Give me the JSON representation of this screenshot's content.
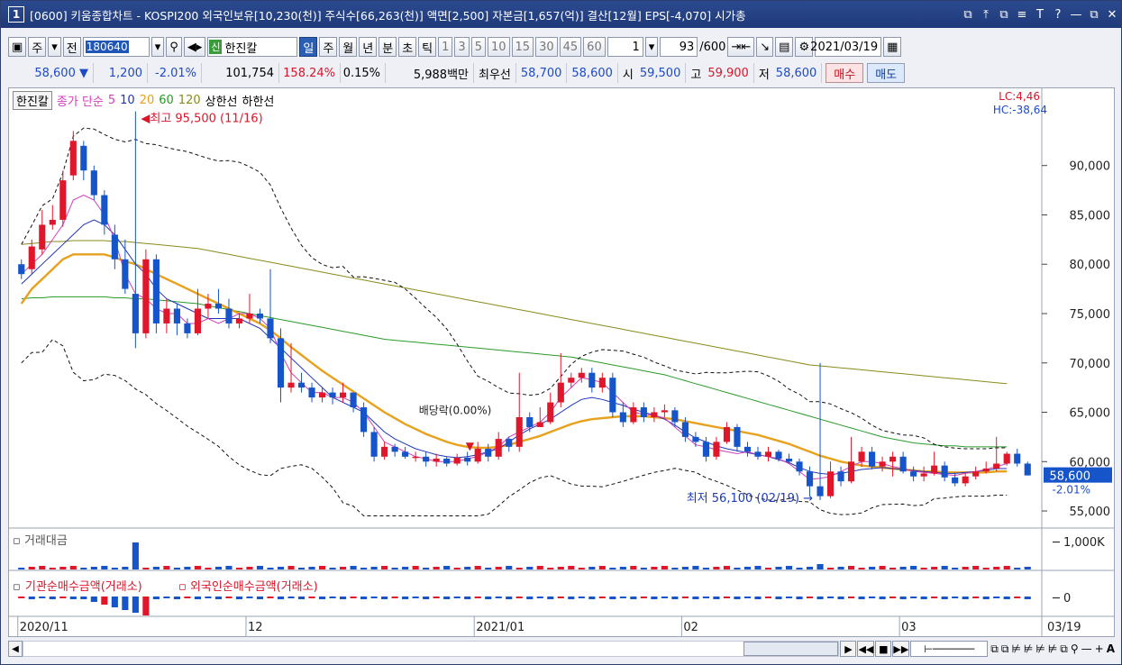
{
  "window": {
    "number": "1",
    "title": "[0600] 키움종합차트 - KOSPI200 외국인보유[10,230(천)] 주식수[66,263(천)] 액면[2,500] 자본금[1,657(억)] 결산[12월] EPS[-4,070] 시가총",
    "buttons": [
      "⧉",
      "⤒",
      "⧉",
      "≡",
      "T",
      "?",
      "—",
      "⧉",
      "✕"
    ]
  },
  "toolbar": {
    "market": "주",
    "all": "전",
    "code": "180640",
    "name_tag": "신",
    "name": "한진칼",
    "periods": [
      "일",
      "주",
      "월",
      "년",
      "분",
      "초",
      "틱"
    ],
    "selected_period": "일",
    "minute_steps": [
      "1",
      "3",
      "5",
      "10",
      "15",
      "30",
      "45",
      "60"
    ],
    "count_select": "1",
    "range": "93",
    "range_total": "/600",
    "date": "2021/03/19"
  },
  "quote": {
    "price": "58,600",
    "arrow": "▼",
    "change": "1,200",
    "change_pct": "-2.01%",
    "volume": "101,754",
    "volume_ratio": "158.24%",
    "turnover": "0.15%",
    "amount": "5,988백만",
    "best_label": "최우선",
    "ask": "58,700",
    "bid": "58,600",
    "open_label": "시",
    "open": "59,500",
    "high_label": "고",
    "high": "59,900",
    "low_label": "저",
    "low": "58,600",
    "buy": "매수",
    "sell": "매도"
  },
  "legend": {
    "name": "한진칼",
    "close_label": "종가 단순",
    "ma": [
      "5",
      "10",
      "20",
      "60",
      "120"
    ],
    "ma_colors": [
      "#d13fb8",
      "#2036b8",
      "#e8a11c",
      "#2a9a2a",
      "#8a8a1d"
    ],
    "upper": "상한선",
    "lower": "하한선"
  },
  "indicators": {
    "lc": "LC:4,46",
    "hc": "HC:-38,64",
    "panel2": "거래대금",
    "panel3a": "기관순매수금액(거래소)",
    "panel3b": "외국인순매수금액(거래소)",
    "panel2_unit": "1,000K",
    "panel3_zero": "0"
  },
  "annotations": {
    "high": "최고 95,500 (11/16)",
    "low": "최저 56,100 (02/19)",
    "dividend": "배당락(0.00%)",
    "last_price": "58,600",
    "last_pct": "-2.01%"
  },
  "x_axis": {
    "labels": [
      "2020/11",
      "12",
      "2021/01",
      "02",
      "03",
      "03/19"
    ]
  },
  "chart_data": {
    "type": "candlestick",
    "y_ticks": [
      55000,
      60000,
      65000,
      70000,
      75000,
      80000,
      85000,
      90000
    ],
    "y_tick_labels": [
      "55,000",
      "60,000",
      "65,000",
      "70,000",
      "75,000",
      "80,000",
      "85,000",
      "90,000"
    ],
    "ylim": [
      54000,
      96000
    ],
    "candles": [
      [
        80000,
        79000,
        80500,
        78500
      ],
      [
        79500,
        81800,
        82500,
        79000
      ],
      [
        81500,
        84000,
        85500,
        81000
      ],
      [
        84000,
        84500,
        86000,
        83500
      ],
      [
        84500,
        88500,
        89500,
        83800
      ],
      [
        89000,
        92500,
        93500,
        88500
      ],
      [
        92000,
        89500,
        92500,
        88500
      ],
      [
        89500,
        87000,
        90000,
        86500
      ],
      [
        87000,
        84000,
        87500,
        83000
      ],
      [
        83000,
        80500,
        84000,
        79500
      ],
      [
        80500,
        77500,
        82500,
        77000
      ],
      [
        77000,
        73000,
        95500,
        71500
      ],
      [
        73000,
        80500,
        81500,
        72500
      ],
      [
        80500,
        74000,
        81000,
        73000
      ],
      [
        74000,
        75500,
        76500,
        73000
      ],
      [
        75500,
        74000,
        76000,
        72800
      ],
      [
        74000,
        73000,
        74500,
        72500
      ],
      [
        73000,
        75500,
        77500,
        72800
      ],
      [
        75500,
        76000,
        77000,
        74500
      ],
      [
        76000,
        75500,
        77500,
        75000
      ],
      [
        75500,
        74000,
        76500,
        73500
      ],
      [
        74000,
        74500,
        75000,
        73500
      ],
      [
        74500,
        75000,
        77000,
        74000
      ],
      [
        75000,
        74500,
        75500,
        74000
      ],
      [
        74500,
        72500,
        79500,
        72000
      ],
      [
        72500,
        67500,
        73500,
        66000
      ],
      [
        67500,
        68000,
        72000,
        67000
      ],
      [
        68000,
        67500,
        69000,
        67000
      ],
      [
        67500,
        66500,
        68000,
        66000
      ],
      [
        66500,
        67000,
        67500,
        66000
      ],
      [
        67000,
        66500,
        67500,
        65800
      ],
      [
        66500,
        67000,
        68000,
        66000
      ],
      [
        67000,
        65500,
        67000,
        65000
      ],
      [
        65500,
        63000,
        66000,
        62500
      ],
      [
        63000,
        60500,
        63500,
        60000
      ],
      [
        60500,
        61500,
        62000,
        60200
      ],
      [
        61500,
        61000,
        61800,
        60500
      ],
      [
        61000,
        60500,
        61500,
        60300
      ],
      [
        60500,
        60500,
        61000,
        60000
      ],
      [
        60500,
        60000,
        61000,
        59500
      ],
      [
        60000,
        60300,
        60800,
        59500
      ],
      [
        60300,
        59800,
        60500,
        59500
      ],
      [
        59800,
        60400,
        60800,
        59600
      ],
      [
        60400,
        60000,
        61000,
        59600
      ],
      [
        60000,
        61300,
        62000,
        59800
      ],
      [
        61300,
        60500,
        61800,
        60000
      ],
      [
        60500,
        62300,
        63000,
        60200
      ],
      [
        62300,
        61500,
        62500,
        61000
      ],
      [
        61500,
        64500,
        69000,
        61000
      ],
      [
        64500,
        63500,
        65000,
        63000
      ],
      [
        63500,
        64000,
        65500,
        63500
      ],
      [
        64000,
        66000,
        67000,
        63800
      ],
      [
        66000,
        68000,
        71000,
        65500
      ],
      [
        68000,
        68500,
        69000,
        67500
      ],
      [
        68500,
        69000,
        69500,
        68000
      ],
      [
        69000,
        67500,
        69500,
        67000
      ],
      [
        67500,
        68500,
        69000,
        67000
      ],
      [
        68500,
        65000,
        69000,
        64500
      ],
      [
        65000,
        64000,
        66000,
        63500
      ],
      [
        64000,
        65500,
        66000,
        63800
      ],
      [
        65500,
        64500,
        66000,
        64000
      ],
      [
        64500,
        65000,
        65500,
        64000
      ],
      [
        65000,
        65200,
        65800,
        64500
      ],
      [
        65200,
        64000,
        65500,
        63500
      ],
      [
        64000,
        62500,
        64500,
        62000
      ],
      [
        62500,
        62000,
        63000,
        61500
      ],
      [
        62000,
        60500,
        62500,
        60000
      ],
      [
        60500,
        62000,
        62500,
        60200
      ],
      [
        62000,
        63500,
        64000,
        61800
      ],
      [
        63500,
        61500,
        63800,
        61000
      ],
      [
        61500,
        61000,
        62000,
        60500
      ],
      [
        61000,
        60500,
        61500,
        60200
      ],
      [
        60500,
        61000,
        61500,
        60000
      ],
      [
        61000,
        60300,
        61200,
        60000
      ],
      [
        60300,
        60000,
        60800,
        59800
      ],
      [
        60000,
        59000,
        60300,
        58600
      ],
      [
        59000,
        57500,
        59500,
        56500
      ],
      [
        57500,
        56500,
        70000,
        56100
      ],
      [
        56500,
        59000,
        60000,
        56300
      ],
      [
        59000,
        58000,
        59500,
        57500
      ],
      [
        58000,
        60000,
        62500,
        57800
      ],
      [
        60000,
        61000,
        61500,
        59500
      ],
      [
        61000,
        59500,
        61500,
        59200
      ],
      [
        59500,
        60000,
        60500,
        59000
      ],
      [
        60000,
        60500,
        61000,
        58500
      ],
      [
        60500,
        59000,
        61000,
        58800
      ],
      [
        59000,
        58500,
        59500,
        58000
      ],
      [
        58500,
        58800,
        59500,
        58000
      ],
      [
        58800,
        59600,
        61000,
        58600
      ],
      [
        59600,
        58400,
        60000,
        58000
      ],
      [
        58400,
        57800,
        58900,
        57500
      ],
      [
        57800,
        58500,
        58800,
        57500
      ],
      [
        58500,
        59000,
        59500,
        58200
      ],
      [
        59000,
        59300,
        60000,
        58800
      ],
      [
        59300,
        59800,
        62500,
        59000
      ],
      [
        59800,
        60800,
        61000,
        59600
      ],
      [
        60800,
        59800,
        61300,
        59500
      ],
      [
        59800,
        58600,
        60000,
        58600
      ]
    ],
    "ma_series": {
      "ma5": [
        79000,
        80000,
        81000,
        82500,
        84000,
        86500,
        87000,
        86500,
        85000,
        82500,
        79000,
        77000,
        76500,
        75500,
        75000,
        75000,
        74000,
        74000,
        74500,
        74000,
        74500,
        75000,
        75000,
        74500,
        73500,
        71000,
        69000,
        68000,
        67000,
        67000,
        66500,
        66500,
        66000,
        65000,
        63500,
        62000,
        61500,
        61000,
        60500,
        60300,
        60000,
        60000,
        60000,
        60300,
        60500,
        61000,
        61500,
        62500,
        63000,
        63500,
        64000,
        65000,
        66500,
        67500,
        68500,
        68300,
        68000,
        67000,
        66000,
        65000,
        64800,
        64700,
        64400,
        63500,
        62600,
        61700,
        61500,
        61200,
        61000,
        60800,
        61000,
        60700,
        60500,
        60300,
        59800,
        59000,
        58200,
        58300,
        58500,
        59000,
        59500,
        60000,
        60000,
        59800,
        59500,
        59300,
        59000,
        58900,
        58800,
        58700,
        58600,
        58800,
        59000,
        59200,
        59500,
        59800
      ],
      "ma10": [
        78000,
        79000,
        80000,
        81000,
        82000,
        83000,
        84000,
        84500,
        84000,
        83000,
        81500,
        80000,
        79000,
        77500,
        76500,
        76000,
        75500,
        75000,
        74500,
        74500,
        74500,
        74500,
        74000,
        73500,
        72500,
        71500,
        70500,
        69500,
        68500,
        67500,
        66500,
        66000,
        65500,
        65000,
        64000,
        63000,
        62300,
        61800,
        61300,
        61000,
        60700,
        60500,
        60400,
        60500,
        60700,
        61000,
        61300,
        62000,
        62700,
        63300,
        63800,
        64300,
        65000,
        65700,
        66300,
        66500,
        66300,
        66000,
        65700,
        65300,
        65000,
        64700,
        64300,
        63700,
        63000,
        62400,
        62000,
        61600,
        61300,
        61100,
        60900,
        60700,
        60500,
        60200,
        59900,
        59400,
        59000,
        58800,
        58700,
        58800,
        59000,
        59200,
        59300,
        59400,
        59300,
        59200,
        59100,
        59000,
        58900,
        58800,
        58800,
        58900,
        59000,
        59100,
        59300,
        59300
      ],
      "ma20": [
        76000,
        77500,
        78500,
        79500,
        80500,
        81000,
        81000,
        81000,
        81000,
        80700,
        80300,
        80000,
        79500,
        79000,
        78500,
        78000,
        77500,
        77000,
        76500,
        76000,
        75500,
        75000,
        74500,
        74000,
        73300,
        72500,
        71600,
        70800,
        70000,
        69200,
        68500,
        67800,
        67100,
        66400,
        65700,
        65000,
        64400,
        63800,
        63300,
        62800,
        62400,
        62000,
        61700,
        61500,
        61400,
        61400,
        61500,
        61700,
        62000,
        62300,
        62600,
        63000,
        63400,
        63800,
        64100,
        64300,
        64400,
        64500,
        64600,
        64600,
        64600,
        64500,
        64400,
        64300,
        64100,
        63900,
        63700,
        63500,
        63300,
        63100,
        62900,
        62700,
        62400,
        62100,
        61800,
        61400,
        61000,
        60600,
        60300,
        60000,
        59800,
        59600,
        59500,
        59400,
        59300,
        59200,
        59100,
        59000,
        59000,
        58900,
        58900,
        58900,
        58900,
        58900,
        59000,
        59000
      ],
      "ma60": [
        76500,
        76600,
        76600,
        76700,
        76700,
        76700,
        76700,
        76700,
        76700,
        76600,
        76600,
        76500,
        76500,
        76400,
        76300,
        76200,
        76100,
        76000,
        75800,
        75600,
        75400,
        75200,
        75000,
        74800,
        74600,
        74400,
        74200,
        74000,
        73800,
        73600,
        73400,
        73200,
        73000,
        72800,
        72600,
        72400,
        72300,
        72200,
        72100,
        72000,
        71900,
        71800,
        71700,
        71600,
        71500,
        71400,
        71300,
        71200,
        71100,
        71000,
        70900,
        70800,
        70700,
        70600,
        70400,
        70200,
        70000,
        69800,
        69600,
        69400,
        69200,
        69000,
        68800,
        68500,
        68200,
        67900,
        67600,
        67300,
        67000,
        66700,
        66400,
        66100,
        65800,
        65500,
        65200,
        64900,
        64600,
        64300,
        64000,
        63700,
        63400,
        63100,
        62800,
        62500,
        62300,
        62100,
        61900,
        61800,
        61700,
        61600,
        61600,
        61500,
        61500,
        61500,
        61500,
        61500
      ],
      "ma120": [
        82000,
        82100,
        82200,
        82300,
        82300,
        82400,
        82400,
        82400,
        82400,
        82300,
        82300,
        82200,
        82100,
        82000,
        81900,
        81800,
        81700,
        81600,
        81400,
        81200,
        81000,
        80800,
        80600,
        80400,
        80200,
        80000,
        79800,
        79600,
        79400,
        79200,
        79000,
        78800,
        78600,
        78400,
        78200,
        78000,
        77800,
        77600,
        77400,
        77200,
        77000,
        76800,
        76600,
        76400,
        76200,
        76000,
        75800,
        75600,
        75400,
        75200,
        75000,
        74800,
        74600,
        74400,
        74200,
        74000,
        73800,
        73600,
        73400,
        73200,
        73000,
        72800,
        72600,
        72400,
        72200,
        72000,
        71800,
        71600,
        71400,
        71200,
        71000,
        70800,
        70600,
        70400,
        70200,
        70000,
        69800,
        69700,
        69600,
        69500,
        69400,
        69300,
        69200,
        69100,
        69000,
        68900,
        68800,
        68700,
        68600,
        68500,
        68400,
        68300,
        68200,
        68100,
        68000,
        67900
      ]
    }
  }
}
